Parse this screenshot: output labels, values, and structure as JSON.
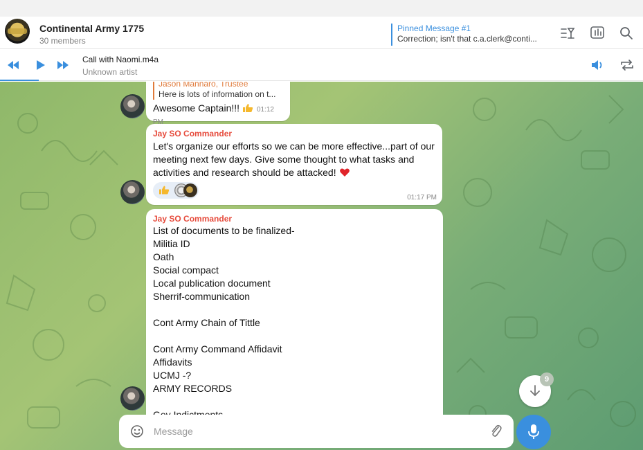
{
  "header": {
    "title": "Continental Army 1775",
    "members": "30 members",
    "pinned": {
      "title": "Pinned Message #1",
      "text": "Correction; isn't that c.a.clerk@conti..."
    }
  },
  "player": {
    "track_title": "Call with Naomi.m4a",
    "artist": "Unknown artist",
    "progress_fraction": 0.06
  },
  "messages": [
    {
      "reply_name": "Jason Mannaro, Trustee",
      "reply_text": "Here is lots of information on t...",
      "text": "Awesome Captain!!!",
      "time": "01:12 PM"
    },
    {
      "sender": "Jay SO Commander",
      "text": "Let's organize our efforts so we can be more effective...part of our meeting next few days. Give some thought to what tasks and activities and research should be attacked!",
      "time": "01:17 PM"
    },
    {
      "sender": "Jay SO Commander",
      "lines": [
        "List of documents to be finalized-",
        "Militia ID",
        "Oath",
        "Social compact",
        "Local publication document",
        "Sherrif-communication",
        "",
        "Cont Army Chain of Tittle",
        "",
        "Cont Army Command Affidavit",
        "Affidavits",
        "UCMJ -?",
        "ARMY RECORDS",
        "",
        "Gov Indictments"
      ]
    }
  ],
  "unread_count": "9",
  "composer": {
    "placeholder": "Message"
  },
  "colors": {
    "accent": "#3a8fde",
    "sender": "#e64a3b",
    "reply": "#e07a3a",
    "chat_bg": "#8fb86a"
  },
  "icons": [
    "search-icon",
    "poll-icon",
    "filter-icon",
    "rewind-icon",
    "play-icon",
    "forward-icon",
    "volume-icon",
    "repeat-icon",
    "emoji-icon",
    "attach-icon",
    "mic-icon",
    "arrow-down-icon"
  ]
}
